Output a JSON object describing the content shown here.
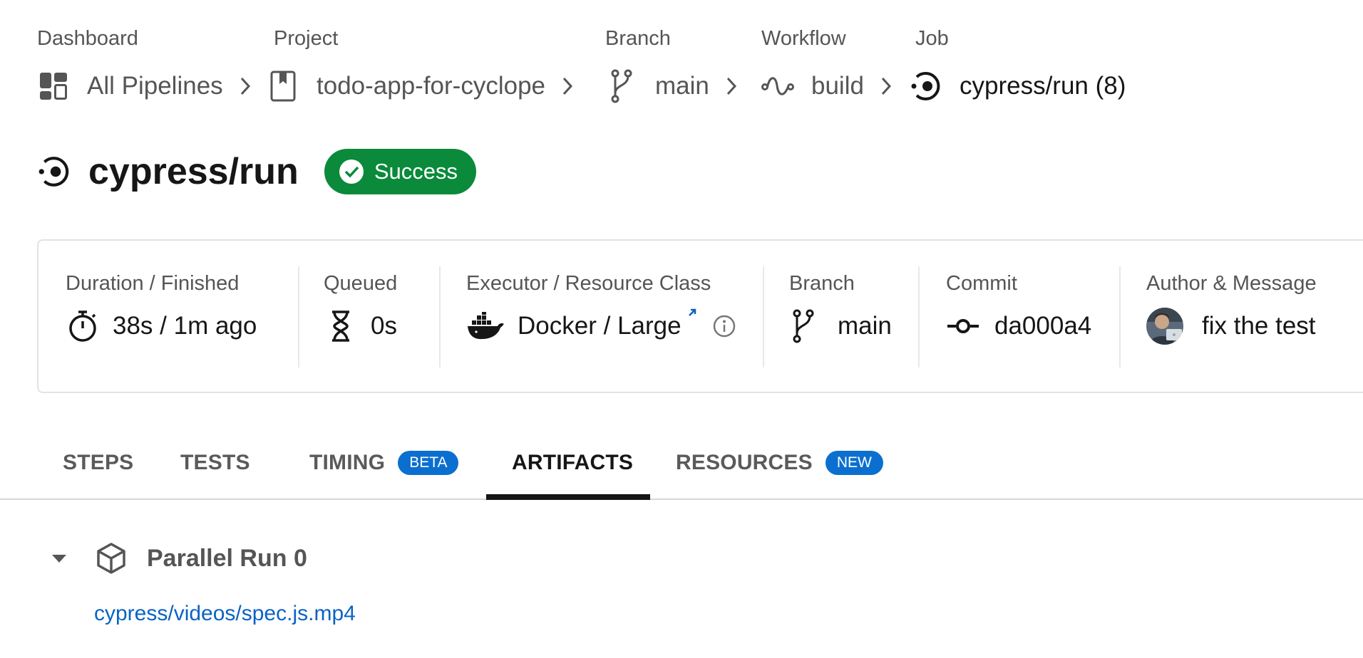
{
  "breadcrumb": {
    "dashboard": {
      "label": "Dashboard",
      "value": "All Pipelines",
      "icon": "dashboard-icon"
    },
    "project": {
      "label": "Project",
      "value": "todo-app-for-cyclope",
      "icon": "repo-icon"
    },
    "branch": {
      "label": "Branch",
      "value": "main",
      "icon": "branch-icon"
    },
    "workflow": {
      "label": "Workflow",
      "value": "build",
      "icon": "workflow-icon"
    },
    "job": {
      "label": "Job",
      "value": "cypress/run (8)",
      "icon": "job-icon"
    }
  },
  "job": {
    "title": "cypress/run",
    "status": "Success",
    "status_color": "#0a8a3a"
  },
  "info": {
    "duration": {
      "label": "Duration / Finished",
      "value": "38s / 1m ago",
      "icon": "stopwatch-icon"
    },
    "queued": {
      "label": "Queued",
      "value": "0s",
      "icon": "hourglass-icon"
    },
    "executor": {
      "label": "Executor / Resource Class",
      "executor": "Docker",
      "separator": " / ",
      "resource_class": "Large",
      "icon": "docker-icon"
    },
    "branch": {
      "label": "Branch",
      "value": "main",
      "icon": "branch-icon"
    },
    "commit": {
      "label": "Commit",
      "value": "da000a4",
      "icon": "commit-icon"
    },
    "author": {
      "label": "Author & Message",
      "message": "fix the test",
      "icon": "avatar"
    }
  },
  "tabs": [
    {
      "label": "STEPS",
      "badge": ""
    },
    {
      "label": "TESTS",
      "badge": ""
    },
    {
      "label": "TIMING",
      "badge": "BETA"
    },
    {
      "label": "ARTIFACTS",
      "badge": ""
    },
    {
      "label": "RESOURCES",
      "badge": "NEW"
    }
  ],
  "active_tab": "ARTIFACTS",
  "artifacts": {
    "group_title": "Parallel Run 0",
    "files": [
      "cypress/videos/spec.js.mp4"
    ]
  },
  "colors": {
    "link": "#0b63c4",
    "badge": "#0b6fd0",
    "success": "#0a8a3a"
  }
}
